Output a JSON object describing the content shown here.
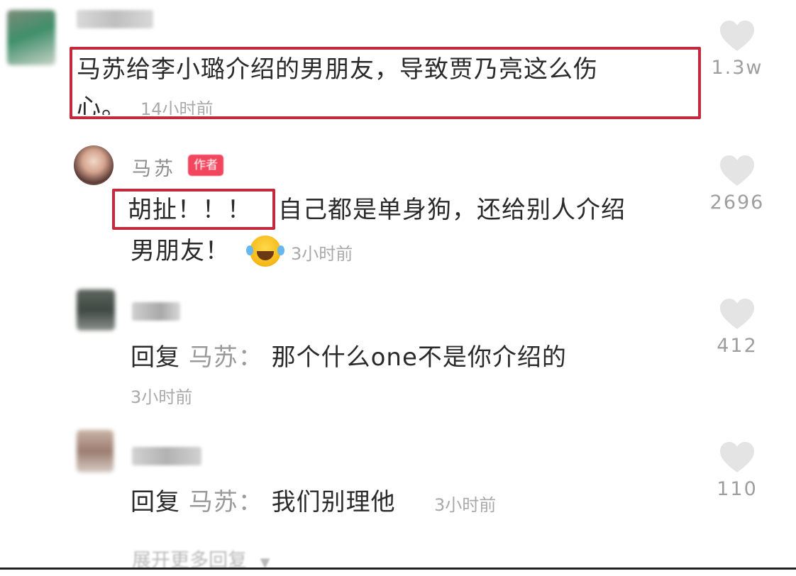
{
  "comments": [
    {
      "text": "马苏给李小璐介绍的男朋友，导致贾乃亮这么伤",
      "text_line2": "心。",
      "time": "14小时前",
      "likes": "1.3w"
    },
    {
      "author": "马苏",
      "badge": "作者",
      "highlight": "胡扯！！！",
      "text": "自己都是单身狗，还给别人介绍",
      "text_line2": "男朋友！",
      "time": "3小时前",
      "likes": "2696"
    },
    {
      "reply_prefix": "回复",
      "reply_target": "马苏：",
      "text": "那个什么one不是你介绍的",
      "time": "3小时前",
      "likes": "412"
    },
    {
      "reply_prefix": "回复",
      "reply_target": "马苏：",
      "text": "我们别理他",
      "time": "3小时前",
      "likes": "110"
    }
  ],
  "expand_label": "展开更多回复",
  "icons": {
    "like": "heart-icon",
    "emoji": "laughing-tears-emoji-icon",
    "expand": "triangle-down-icon"
  },
  "colors": {
    "highlight_box": "#c42a3d",
    "badge": "#f2465f",
    "text": "#2a2a2a",
    "muted": "#a9a9a9"
  }
}
